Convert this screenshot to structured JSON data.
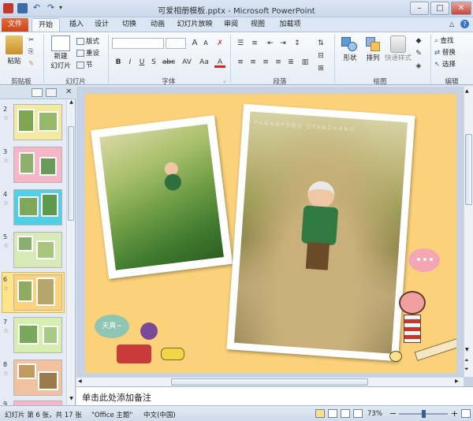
{
  "window": {
    "title": "可爱相册模板.pptx - Microsoft PowerPoint",
    "minimize_glyph": "–",
    "maximize_glyph": "□",
    "close_glyph": "✕"
  },
  "tabs": [
    "文件",
    "开始",
    "插入",
    "设计",
    "切换",
    "动画",
    "幻灯片放映",
    "审阅",
    "视图",
    "加载项"
  ],
  "ribbon": {
    "clipboard": {
      "paste": "粘贴",
      "group": "剪贴板"
    },
    "slides": {
      "new_slide_1": "新建",
      "new_slide_2": "幻灯片",
      "layout": "版式",
      "reset": "重设",
      "section": "节",
      "group": "幻灯片"
    },
    "font": {
      "bold": "B",
      "italic": "I",
      "underline": "U",
      "strike": "S",
      "abc": "abc",
      "spacing": "AV",
      "case": "Aa",
      "color": "A",
      "grow": "A",
      "shrink": "A",
      "group": "字体"
    },
    "paragraph": {
      "group": "段落"
    },
    "drawing": {
      "shapes": "形状",
      "arrange": "排列",
      "quick_styles": "快速样式",
      "group": "绘图"
    },
    "editing": {
      "find": "查找",
      "replace": "替换",
      "select": "选择",
      "group": "编辑"
    }
  },
  "thumbnails": [
    {
      "num": "2",
      "star": "☆"
    },
    {
      "num": "3",
      "star": "☆"
    },
    {
      "num": "4",
      "star": "☆"
    },
    {
      "num": "5",
      "star": "☆"
    },
    {
      "num": "6",
      "star": "☆"
    },
    {
      "num": "7",
      "star": "☆"
    },
    {
      "num": "8",
      "star": "☆"
    },
    {
      "num": "9",
      "star": "☆"
    }
  ],
  "slide": {
    "watermark": "PANANPONG OYANZHANG",
    "bubble_text": "天真~"
  },
  "notes_placeholder": "单击此处添加备注",
  "status": {
    "slide_info": "幻灯片 第 6 张，共 17 张",
    "theme": "\"Office 主题\"",
    "language": "中文(中国)",
    "zoom": "73%",
    "zoom_minus": "−",
    "zoom_plus": "+"
  },
  "colors": {
    "file_tab": "#d7582a",
    "slide_bg": "#fbd27a",
    "ribbon_bg": "#eef3f9",
    "selected_thumb": "#ffd96b"
  }
}
